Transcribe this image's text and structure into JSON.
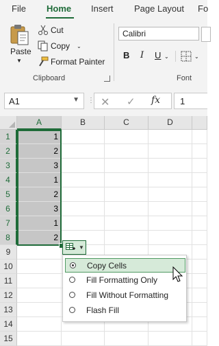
{
  "ribbon": {
    "tabs": [
      "File",
      "Home",
      "Insert",
      "Page Layout",
      "Fo"
    ],
    "active_tab": "Home",
    "clipboard": {
      "paste": "Paste",
      "cut": "Cut",
      "copy": "Copy",
      "format_painter": "Format Painter",
      "group_label": "Clipboard"
    },
    "font": {
      "font_name": "Calibri",
      "bold": "B",
      "italic": "I",
      "underline": "U",
      "group_label": "Font"
    }
  },
  "formula_bar": {
    "name_box": "A1",
    "fx": "fx",
    "value": "1"
  },
  "grid": {
    "columns": [
      "A",
      "B",
      "C",
      "D"
    ],
    "rows": [
      "1",
      "2",
      "3",
      "4",
      "5",
      "6",
      "7",
      "8",
      "9",
      "10",
      "11",
      "12",
      "13",
      "14",
      "15"
    ],
    "selected_column": "A",
    "column_a_values": [
      "1",
      "2",
      "3",
      "1",
      "2",
      "3",
      "1",
      "2"
    ]
  },
  "autofill_menu": {
    "items": [
      {
        "label": "Copy Cells",
        "selected": true
      },
      {
        "label": "Fill Formatting Only",
        "selected": false
      },
      {
        "label": "Fill Without Formatting",
        "selected": false
      },
      {
        "label": "Flash Fill",
        "selected": false
      }
    ]
  },
  "colors": {
    "accent": "#1e6b38",
    "selection_fill": "#c6c6c6",
    "menu_highlight": "#d6ead9"
  }
}
